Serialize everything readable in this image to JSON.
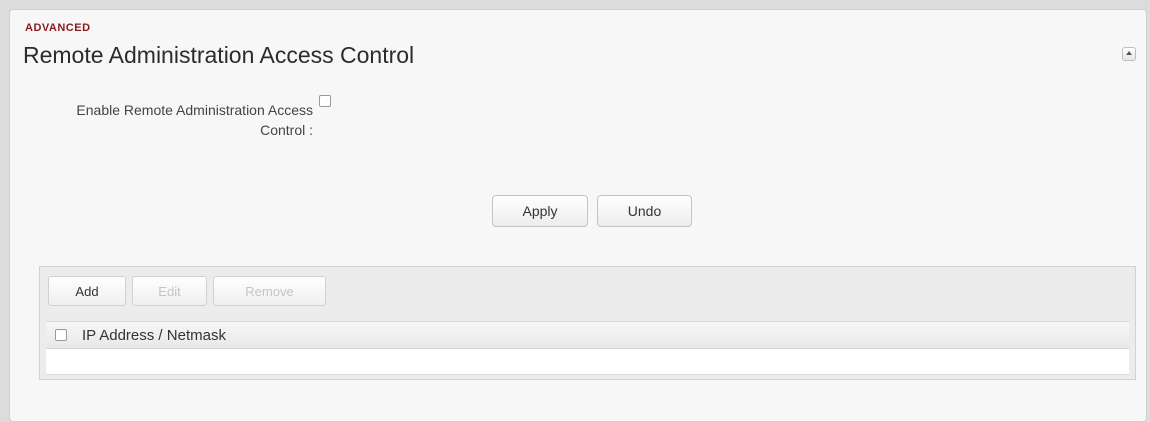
{
  "section": {
    "eyebrow": "ADVANCED",
    "title": "Remote Administration Access Control"
  },
  "form": {
    "enable_label": "Enable Remote Administration Access Control :",
    "enable_checked": false
  },
  "actions": {
    "apply_label": "Apply",
    "undo_label": "Undo"
  },
  "grid": {
    "toolbar": {
      "add_label": "Add",
      "edit_label": "Edit",
      "remove_label": "Remove"
    },
    "columns": [
      "IP Address / Netmask"
    ],
    "rows": []
  },
  "colors": {
    "eyebrow": "#8b1a1a",
    "disabled_text": "#c4c4c4"
  }
}
